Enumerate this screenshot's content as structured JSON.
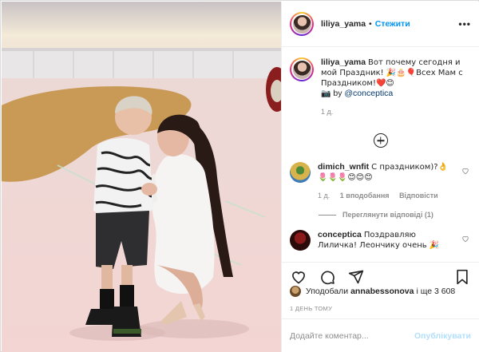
{
  "header": {
    "username": "liliya_yama",
    "separator": "•",
    "follow_label": "Стежити",
    "more_label": "•••"
  },
  "caption": {
    "username": "liliya_yama",
    "text": "Вот почему сегодня и мой Праздник! 🎉🎂🎈Всех Мам с Праздником!❤️😊",
    "photo_credit_icon": "📷",
    "by": "by",
    "mention": "@conceptica",
    "time": "1 д."
  },
  "comments": [
    {
      "username": "dimich_wnfit",
      "text": "С праздником)?👌🌷🌷🌷😊😊😊",
      "time": "1 д.",
      "likes": "1 вподобання",
      "reply": "Відповісти",
      "view_replies": "Переглянути відповіді (1)"
    },
    {
      "username": "conceptica",
      "text": "Поздравляю Лиличка! Леончику очень 🎉"
    }
  ],
  "likes": {
    "prefix": "Уподобали",
    "user": "annabessonova",
    "suffix": "і ще 3 608"
  },
  "time_ago": "1 ДЕНЬ ТОМУ",
  "add_comment": {
    "placeholder": "Додайте коментар...",
    "post_label": "Опублікувати"
  },
  "colors": {
    "accent": "#0095f6",
    "text": "#262626",
    "muted": "#8e8e8e",
    "post_disabled": "#b2dffc"
  }
}
